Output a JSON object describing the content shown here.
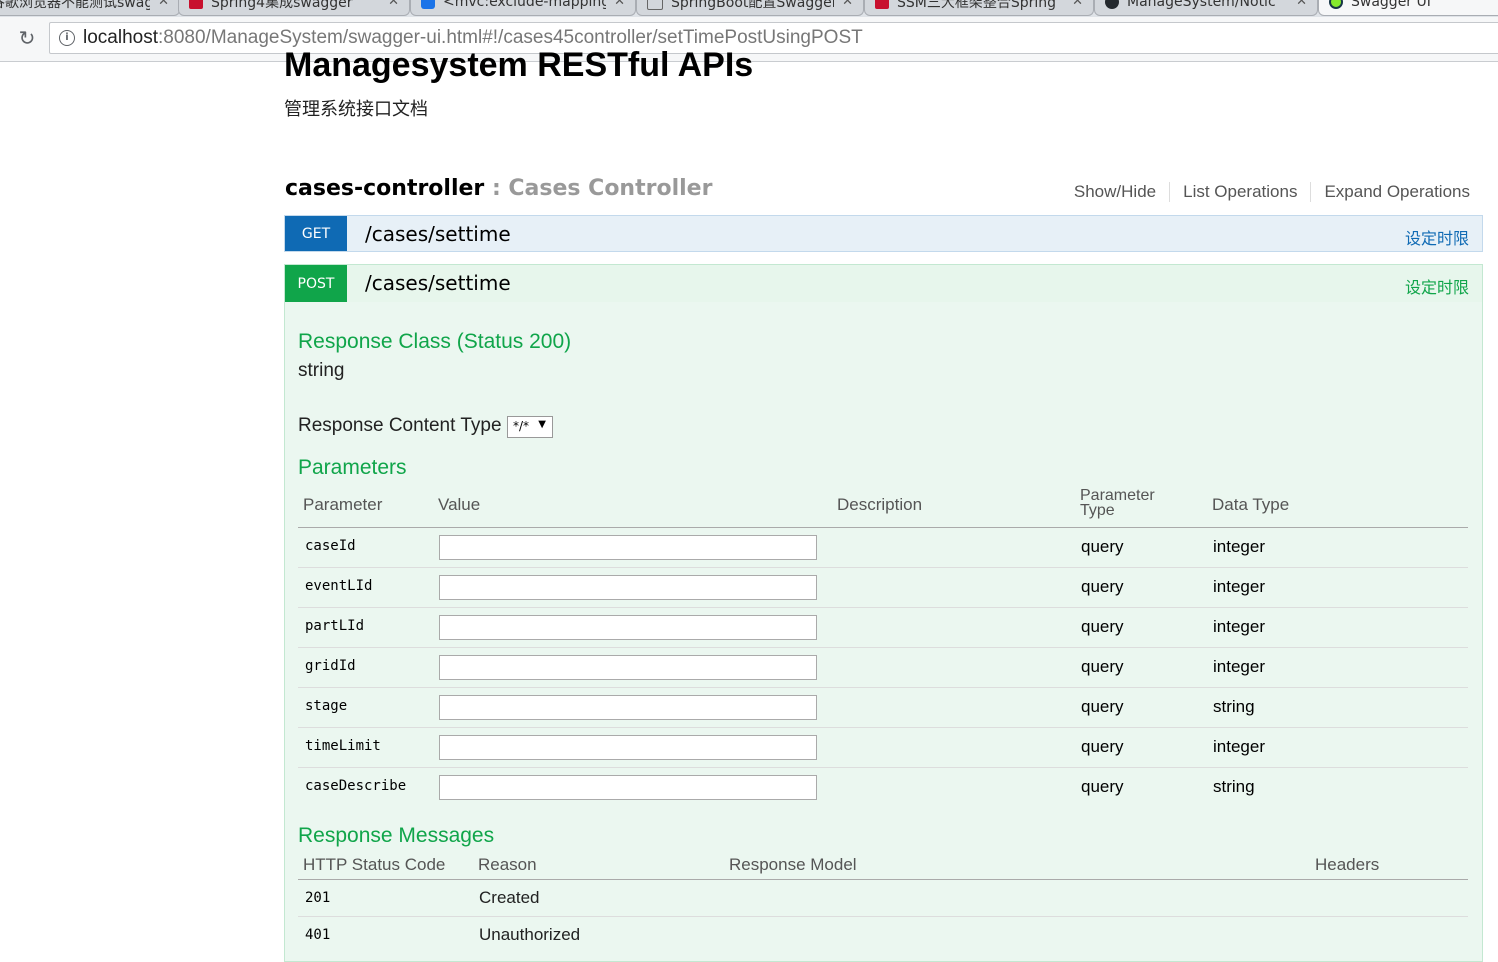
{
  "browser": {
    "tabs": [
      {
        "title": "谷歌浏览器不能测试swagger",
        "icon": "document-icon"
      },
      {
        "title": "Spring4集成swagger",
        "icon": "csdn-icon"
      },
      {
        "title": "<mvc:exclude-mapping",
        "icon": "baidu-icon"
      },
      {
        "title": "SpringBoot配置Swagger",
        "icon": "pen-icon"
      },
      {
        "title": "SSM三大框架整合Spring",
        "icon": "csdn-icon"
      },
      {
        "title": "ManageSystem/Notic",
        "icon": "github-icon"
      },
      {
        "title": "Swagger UI",
        "icon": "swagger-icon"
      }
    ],
    "url_host": "localhost",
    "url_rest": ":8080/ManageSystem/swagger-ui.html#!/cases45controller/setTimePostUsingPOST"
  },
  "api": {
    "title": "Managesystem RESTful APIs",
    "description": "管理系统接口文档"
  },
  "controller": {
    "name": "cases-controller",
    "separator": " : ",
    "description": "Cases Controller",
    "links": [
      "Show/Hide",
      "List Operations",
      "Expand Operations"
    ]
  },
  "operations": {
    "get": {
      "method": "GET",
      "path": "/cases/settime",
      "summary": "设定时限"
    },
    "post": {
      "method": "POST",
      "path": "/cases/settime",
      "summary": "设定时限"
    }
  },
  "detail": {
    "response_class_heading": "Response Class (Status 200)",
    "response_class_value": "string",
    "content_type_label": "Response Content Type",
    "content_type_value": "*/*",
    "parameters_heading": "Parameters",
    "param_headers": {
      "parameter": "Parameter",
      "value": "Value",
      "description": "Description",
      "param_type_1": "Parameter",
      "param_type_2": "Type",
      "data_type": "Data Type"
    },
    "params": [
      {
        "name": "caseId",
        "value": "",
        "type": "query",
        "data_type": "integer"
      },
      {
        "name": "eventLId",
        "value": "",
        "type": "query",
        "data_type": "integer"
      },
      {
        "name": "partLId",
        "value": "",
        "type": "query",
        "data_type": "integer"
      },
      {
        "name": "gridId",
        "value": "",
        "type": "query",
        "data_type": "integer"
      },
      {
        "name": "stage",
        "value": "",
        "type": "query",
        "data_type": "string"
      },
      {
        "name": "timeLimit",
        "value": "",
        "type": "query",
        "data_type": "integer"
      },
      {
        "name": "caseDescribe",
        "value": "",
        "type": "query",
        "data_type": "string"
      }
    ],
    "response_messages_heading": "Response Messages",
    "resp_headers": {
      "code": "HTTP Status Code",
      "reason": "Reason",
      "model": "Response Model",
      "headers": "Headers"
    },
    "responses": [
      {
        "code": "201",
        "reason": "Created"
      },
      {
        "code": "401",
        "reason": "Unauthorized"
      }
    ]
  },
  "colors": {
    "get": "#0f6ab4",
    "post": "#10a54a",
    "post_bg": "#ebf7f0",
    "get_bg": "#e7f0f7"
  }
}
